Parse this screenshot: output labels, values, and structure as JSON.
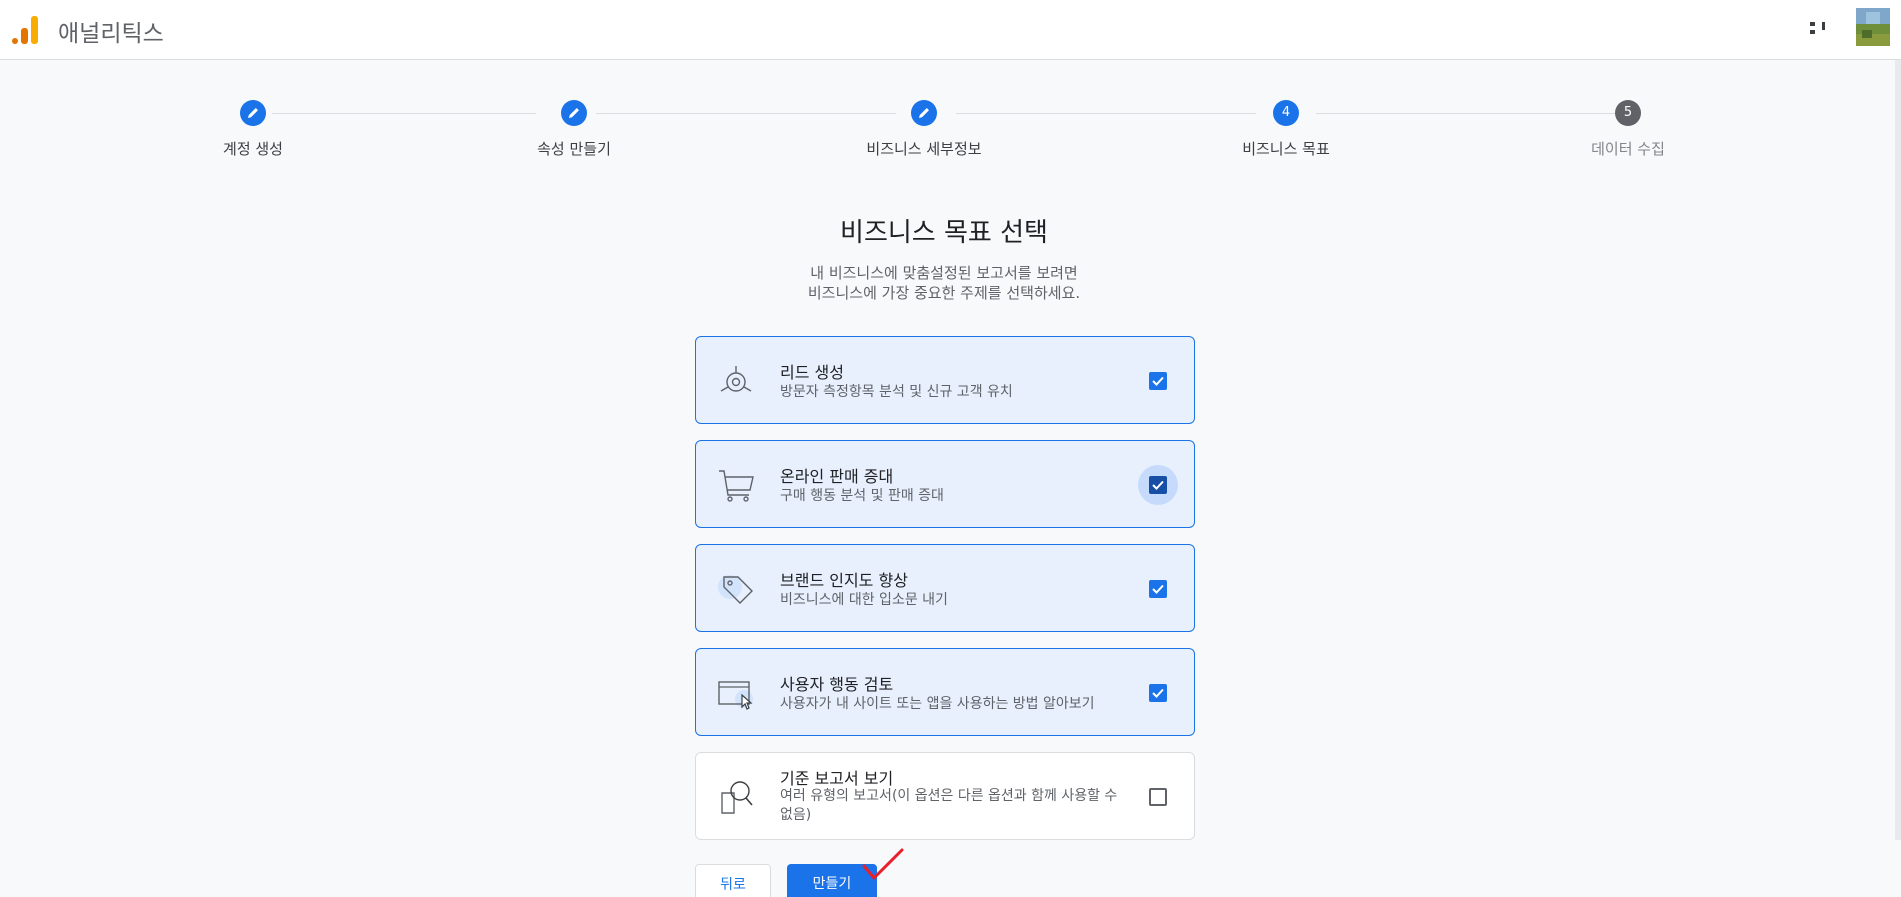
{
  "header": {
    "app_title": "애널리틱스",
    "logo_icon": "analytics-logo-icon",
    "apps_icon": "apps-icon",
    "avatar_icon": "account-avatar"
  },
  "stepper": {
    "steps": [
      {
        "label": "계정 생성",
        "state": "done",
        "icon": "pencil-icon"
      },
      {
        "label": "속성 만들기",
        "state": "done",
        "icon": "pencil-icon"
      },
      {
        "label": "비즈니스 세부정보",
        "state": "done",
        "icon": "pencil-icon"
      },
      {
        "label": "비즈니스 목표",
        "state": "current",
        "number": "4"
      },
      {
        "label": "데이터 수집",
        "state": "todo",
        "number": "5"
      }
    ]
  },
  "main": {
    "title": "비즈니스 목표 선택",
    "description_line1": "내 비즈니스에 맞춤설정된 보고서를 보려면",
    "description_line2": "비즈니스에 가장 중요한 주제를 선택하세요.",
    "options": [
      {
        "title": "리드 생성",
        "desc": "방문자 측정항목 분석 및 신규 고객 유치",
        "checked": true,
        "icon": "target-icon"
      },
      {
        "title": "온라인 판매 증대",
        "desc": "구매 행동 분석 및 판매 증대",
        "checked": true,
        "icon": "shopping-cart-icon"
      },
      {
        "title": "브랜드 인지도 향상",
        "desc": "비즈니스에 대한 입소문 내기",
        "checked": true,
        "icon": "tag-icon"
      },
      {
        "title": "사용자 행동 검토",
        "desc": "사용자가 내 사이트 또는 앱을 사용하는 방법 알아보기",
        "checked": true,
        "icon": "browser-cursor-icon"
      },
      {
        "title": "기준 보고서 보기",
        "desc": "여러 유형의 보고서(이 옵션은 다른 옵션과 함께 사용할 수 없음)",
        "checked": false,
        "icon": "magnifier-report-icon"
      }
    ],
    "back_label": "뒤로",
    "create_label": "만들기"
  },
  "colors": {
    "accent": "#1a73e8",
    "selected_bg": "#e8f0fe",
    "annotation": "#e8202a"
  }
}
